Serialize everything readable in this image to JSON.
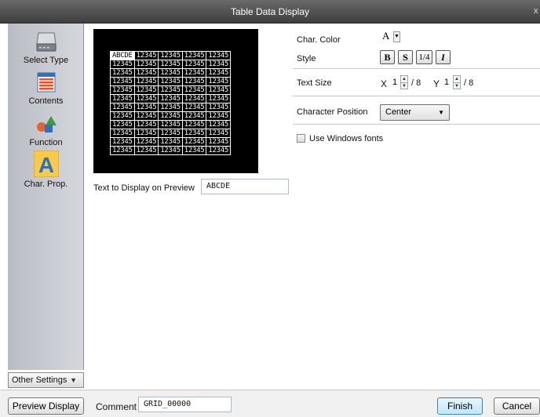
{
  "window": {
    "title": "Table Data Display",
    "close_label": "x"
  },
  "sidebar": {
    "items": [
      {
        "label": "Select Type",
        "icon": "drive-icon"
      },
      {
        "label": "Contents",
        "icon": "table-icon"
      },
      {
        "label": "Function",
        "icon": "shapes-icon"
      },
      {
        "label": "Char. Prop.",
        "icon": "letter-a-icon",
        "active": true
      }
    ],
    "other_settings_label": "Other Settings"
  },
  "preview": {
    "grid": [
      [
        "ABCDE",
        "12345",
        "12345",
        "12345",
        "12345"
      ],
      [
        "12345",
        "12345",
        "12345",
        "12345",
        "12345"
      ],
      [
        "12345",
        "12345",
        "12345",
        "12345",
        "12345"
      ],
      [
        "12345",
        "12345",
        "12345",
        "12345",
        "12345"
      ],
      [
        "12345",
        "12345",
        "12345",
        "12345",
        "12345"
      ],
      [
        "12345",
        "12345",
        "12345",
        "12345",
        "12345"
      ],
      [
        "12345",
        "12345",
        "12345",
        "12345",
        "12345"
      ],
      [
        "12345",
        "12345",
        "12345",
        "12345",
        "12345"
      ],
      [
        "12345",
        "12345",
        "12345",
        "12345",
        "12345"
      ],
      [
        "12345",
        "12345",
        "12345",
        "12345",
        "12345"
      ],
      [
        "12345",
        "12345",
        "12345",
        "12345",
        "12345"
      ],
      [
        "12345",
        "12345",
        "12345",
        "12345",
        "12345"
      ]
    ],
    "text_label": "Text to Display on Preview",
    "text_value": "ABCDE"
  },
  "char_props": {
    "color_label": "Char. Color",
    "color_glyph": "A",
    "style_label": "Style",
    "style_buttons": [
      "B",
      "S",
      "1/4",
      "I"
    ],
    "text_size_label": "Text Size",
    "x_label": "X",
    "x_value": "1",
    "x_suffix": "/ 8",
    "y_label": "Y",
    "y_value": "1",
    "y_suffix": "/ 8",
    "position_label": "Character Position",
    "position_value": "Center",
    "use_windows_fonts_label": "Use Windows fonts",
    "use_windows_fonts": false
  },
  "bottom": {
    "preview_display_label": "Preview Display",
    "comment_label": "Comment",
    "comment_value": "GRID_00000",
    "finish_label": "Finish",
    "cancel_label": "Cancel"
  }
}
